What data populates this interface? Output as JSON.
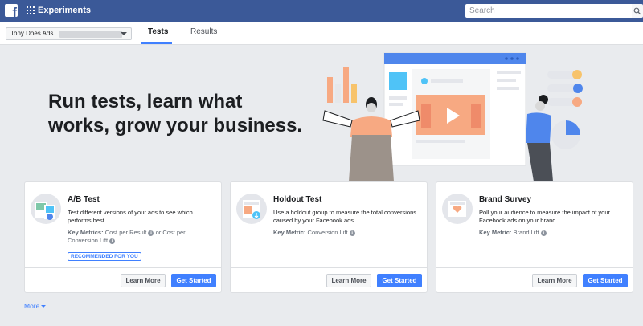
{
  "app": {
    "title": "Experiments"
  },
  "search": {
    "placeholder": "Search"
  },
  "account": {
    "name": "Tony Does Ads"
  },
  "tabs": [
    {
      "label": "Tests",
      "active": true
    },
    {
      "label": "Results",
      "active": false
    }
  ],
  "hero": {
    "line1": "Run tests, learn what",
    "line2": "works, grow your business."
  },
  "cards": [
    {
      "title": "A/B Test",
      "description": "Test different versions of your ads to see which performs best.",
      "metrics_label": "Key Metrics:",
      "metrics_value_1": "Cost per Result",
      "metrics_joiner": "or Cost per",
      "metrics_value_2": "Conversion Lift",
      "badge": "RECOMMENDED FOR YOU",
      "learn_more": "Learn More",
      "get_started": "Get Started"
    },
    {
      "title": "Holdout Test",
      "description": "Use a holdout group to measure the total conversions caused by your Facebook ads.",
      "metrics_label": "Key Metric:",
      "metrics_value_1": "Conversion Lift",
      "learn_more": "Learn More",
      "get_started": "Get Started"
    },
    {
      "title": "Brand Survey",
      "description": "Poll your audience to measure the impact of your Facebook ads on your brand.",
      "metrics_label": "Key Metric:",
      "metrics_value_1": "Brand Lift",
      "learn_more": "Learn More",
      "get_started": "Get Started"
    }
  ],
  "footer": {
    "more_label": "More"
  },
  "colors": {
    "topbar": "#3b5998",
    "accent": "#4080ff",
    "background": "#e9ebee",
    "illustration_orange": "#f7a982",
    "illustration_blue": "#4f86ec",
    "illustration_grey": "#9c928a"
  },
  "icons": [
    "facebook-logo-icon",
    "apps-grid-icon",
    "search-icon",
    "chevron-down-icon",
    "info-icon"
  ]
}
